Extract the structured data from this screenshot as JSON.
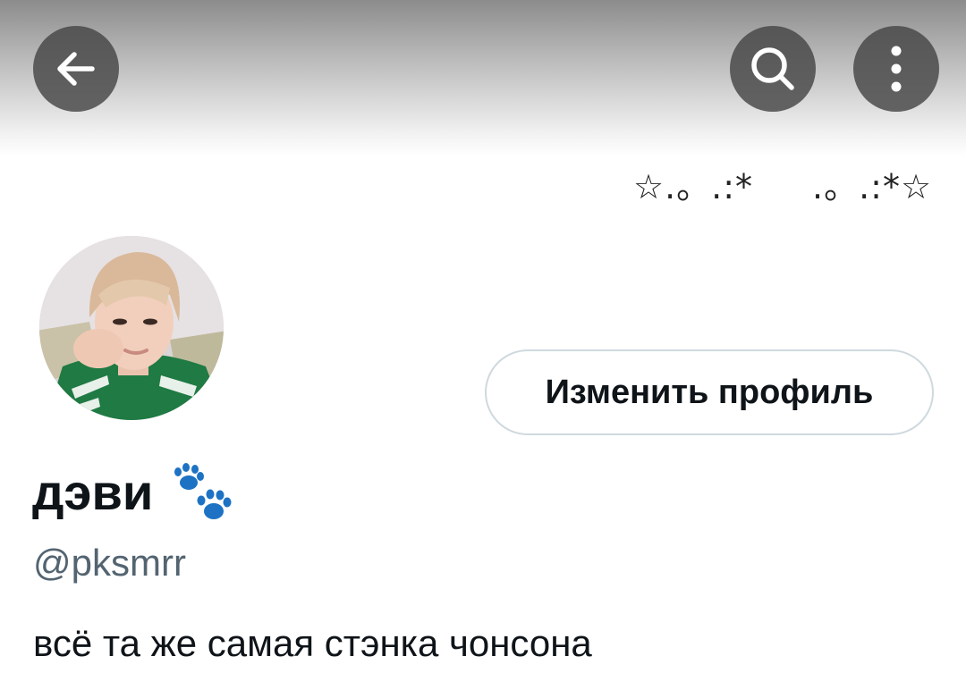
{
  "header": {
    "back_icon": "arrow-left-icon",
    "search_icon": "search-icon",
    "more_icon": "more-vertical-icon"
  },
  "banner": {
    "deco_left": "☆.。.:*",
    "deco_right": ".。.:*☆"
  },
  "profile": {
    "edit_button_label": "Изменить профиль",
    "display_name": "дэви",
    "name_emoji": "paw-prints-icon",
    "handle": "@pksmrr",
    "bio": "всё та же самая стэнка чонсона"
  },
  "colors": {
    "text_primary": "#0f1419",
    "text_secondary": "#536471",
    "button_border": "#cfd9de",
    "paw_blue": "#1d72c4",
    "header_button_bg": "#464646"
  }
}
